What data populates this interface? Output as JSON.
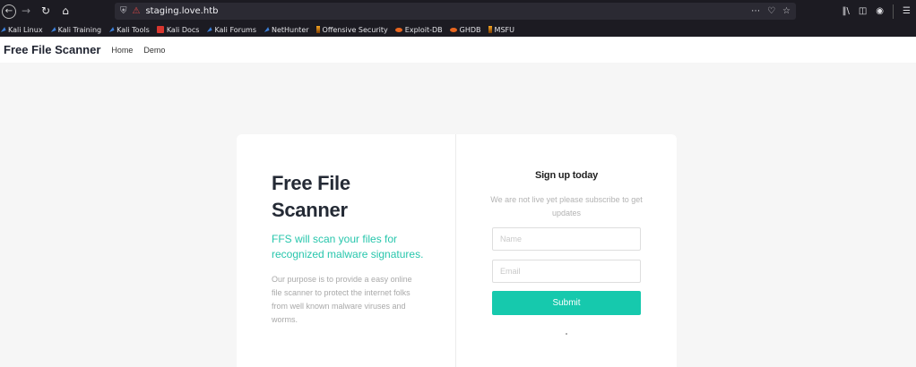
{
  "browser": {
    "url": "staging.love.htb",
    "nav_icons": [
      "back-icon",
      "forward-icon",
      "reload-icon",
      "home-icon"
    ],
    "url_actions": [
      "more-icon",
      "pocket-icon",
      "star-icon"
    ],
    "toolbar_icons": [
      "library-icon",
      "sidebar-icon",
      "account-icon",
      "menu-icon"
    ]
  },
  "bookmarks": [
    {
      "label": "Kali Linux",
      "icon": "kali-icon"
    },
    {
      "label": "Kali Training",
      "icon": "kali-icon"
    },
    {
      "label": "Kali Tools",
      "icon": "kali-icon"
    },
    {
      "label": "Kali Docs",
      "icon": "red-doc-icon"
    },
    {
      "label": "Kali Forums",
      "icon": "kali-icon"
    },
    {
      "label": "NetHunter",
      "icon": "kali-icon"
    },
    {
      "label": "Offensive Security",
      "icon": "offsec-icon"
    },
    {
      "label": "Exploit-DB",
      "icon": "exploitdb-icon"
    },
    {
      "label": "GHDB",
      "icon": "exploitdb-icon"
    },
    {
      "label": "MSFU",
      "icon": "offsec-icon"
    }
  ],
  "site": {
    "brand": "Free File Scanner",
    "nav": [
      "Home",
      "Demo"
    ]
  },
  "hero": {
    "title": "Free File Scanner",
    "subtitle": "FFS will scan your files for recognized malware signatures.",
    "body": "Our purpose is to provide a easy online file scanner to protect the internet folks from well known malware viruses and worms."
  },
  "signup": {
    "title": "Sign up today",
    "note": "We are not live yet please subscribe to get updates",
    "name_placeholder": "Name",
    "email_placeholder": "Email",
    "submit_label": "Submit"
  },
  "colors": {
    "accent": "#16c9ad",
    "subtitle": "#27c6ac",
    "chrome_bg": "#1c1b22"
  }
}
